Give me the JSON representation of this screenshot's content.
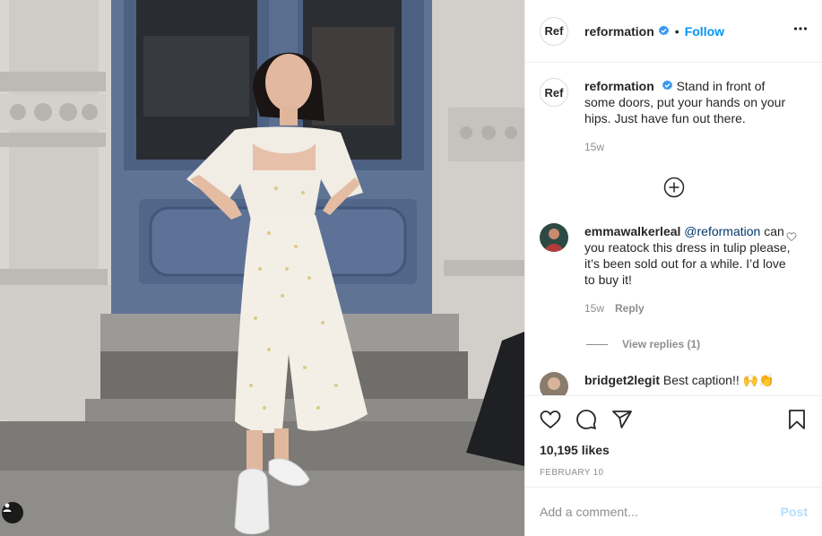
{
  "post": {
    "account": {
      "username": "reformation",
      "avatar_text": "Ref",
      "verified": true,
      "follow_label": "Follow",
      "dot": "•",
      "more_icon": "more-horizontal-icon"
    },
    "caption": {
      "username": "reformation",
      "text": "Stand in front of some doors, put your hands on your hips. Just have fun out there.",
      "time": "15w"
    },
    "comments": [
      {
        "username": "emmawalkerleal",
        "mention": "@reformation",
        "text": "can you reatock this dress in tulip please, it’s been sold out for a while. I’d love to buy it!",
        "time": "15w",
        "reply_label": "Reply",
        "view_replies": "View replies (1)"
      },
      {
        "username": "bridget2legit",
        "text": "Best caption!! 🙌👏"
      }
    ],
    "likes": "10,195 likes",
    "date": "FEBRUARY 10",
    "add_comment_placeholder": "Add a comment...",
    "post_label": "Post"
  },
  "icons": [
    "verified-badge-icon",
    "load-more-icon",
    "heart-icon",
    "comment-icon",
    "share-icon",
    "save-icon",
    "user-tag-icon"
  ],
  "colors": {
    "link": "#0095f6",
    "post_disabled": "#b2dffc",
    "muted": "#8e8e8e",
    "text": "#262626"
  }
}
